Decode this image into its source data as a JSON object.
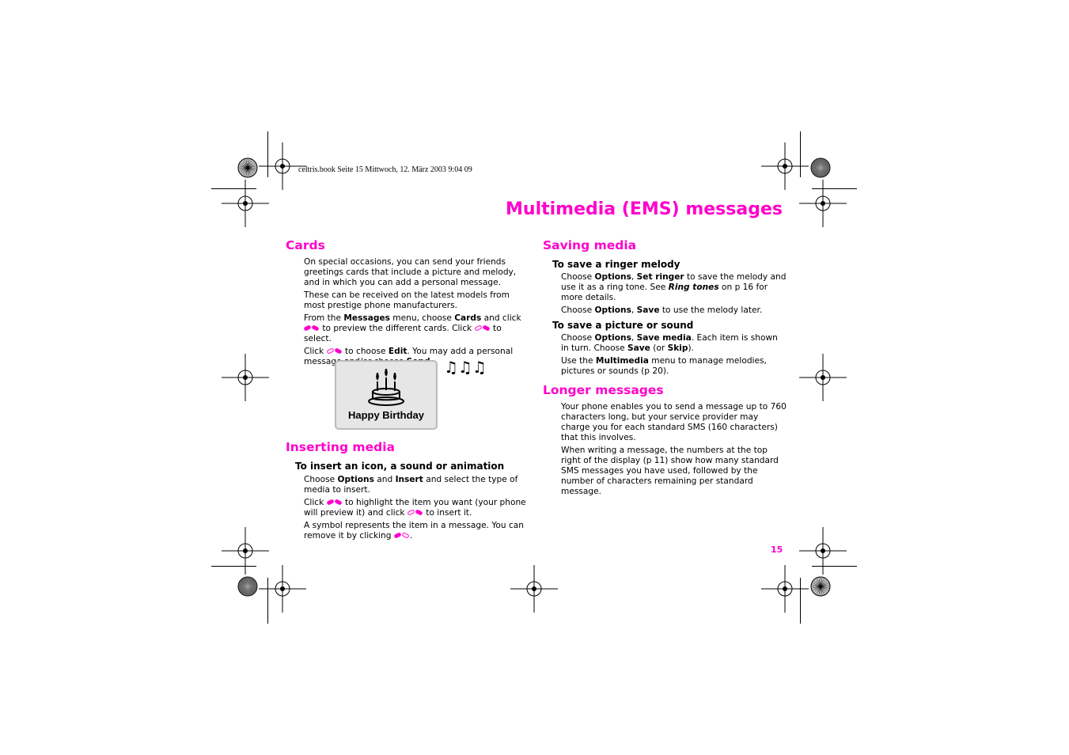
{
  "header": "celtris.book  Seite 15  Mittwoch, 12. März 2003  9:04 09",
  "title": "Multimedia (EMS) messages",
  "page_number": "15",
  "cards": {
    "heading": "Cards",
    "paragraphs": [
      [
        {
          "t": "On special occasions, you can send your friends greetings cards that include a picture and melody, and in which you can add a personal message."
        }
      ],
      [
        {
          "t": "These can be received on the latest models from most prestige phone manufacturers."
        }
      ],
      [
        {
          "t": "From the "
        },
        {
          "t": "Messages",
          "b": 1
        },
        {
          "t": " menu, choose "
        },
        {
          "t": "Cards",
          "b": 1
        },
        {
          "t": " and click "
        },
        {
          "icon": "nav-keys"
        },
        {
          "t": " to preview the different cards. Click "
        },
        {
          "icon": "ok-key"
        },
        {
          "t": " to select."
        }
      ],
      [
        {
          "t": "Click "
        },
        {
          "icon": "ok-key"
        },
        {
          "t": " to choose "
        },
        {
          "t": "Edit",
          "b": 1
        },
        {
          "t": ". You may add a personal message and/or choose "
        },
        {
          "t": "Send",
          "b": 1
        },
        {
          "t": "."
        }
      ]
    ],
    "card_label": "Happy Birthday",
    "notes": "♫♫♫"
  },
  "inserting": {
    "heading": "Inserting media",
    "subheading": "To insert an icon, a sound or animation",
    "paragraphs": [
      [
        {
          "t": "Choose "
        },
        {
          "t": "Options",
          "b": 1
        },
        {
          "t": " and "
        },
        {
          "t": "Insert",
          "b": 1
        },
        {
          "t": " and select the type of media to insert."
        }
      ],
      [
        {
          "t": "Click "
        },
        {
          "icon": "nav-keys"
        },
        {
          "t": " to highlight the item you want (your phone will preview it) and click "
        },
        {
          "icon": "ok-key"
        },
        {
          "t": " to insert it."
        }
      ],
      [
        {
          "t": "A symbol represents the item in a message. You can remove it by clicking "
        },
        {
          "icon": "back-key"
        },
        {
          "t": "."
        }
      ]
    ]
  },
  "saving": {
    "heading": "Saving media",
    "ringer": {
      "subheading": "To save a ringer melody",
      "paragraphs": [
        [
          {
            "t": "Choose "
          },
          {
            "t": "Options",
            "b": 1
          },
          {
            "t": ", "
          },
          {
            "t": "Set ringer",
            "b": 1
          },
          {
            "t": " to save the melody and use it as a ring tone. See "
          },
          {
            "t": "Ring tones",
            "b": 1,
            "i": 1
          },
          {
            "t": " on p 16 for more details."
          }
        ],
        [
          {
            "t": "Choose "
          },
          {
            "t": "Options",
            "b": 1
          },
          {
            "t": ", "
          },
          {
            "t": "Save",
            "b": 1
          },
          {
            "t": " to use the melody later."
          }
        ]
      ]
    },
    "picture": {
      "subheading": "To save a picture or sound",
      "paragraphs": [
        [
          {
            "t": "Choose "
          },
          {
            "t": "Options",
            "b": 1
          },
          {
            "t": ", "
          },
          {
            "t": "Save media",
            "b": 1
          },
          {
            "t": ".  Each item is shown in turn. Choose "
          },
          {
            "t": "Save",
            "b": 1
          },
          {
            "t": " (or "
          },
          {
            "t": "Skip",
            "b": 1
          },
          {
            "t": ")."
          }
        ],
        [
          {
            "t": "Use the "
          },
          {
            "t": "Multimedia",
            "b": 1
          },
          {
            "t": " menu to manage melodies, pictures or sounds (p 20)."
          }
        ]
      ]
    }
  },
  "longer": {
    "heading": "Longer messages",
    "paragraphs": [
      [
        {
          "t": "Your phone enables you to send a message up to 760 characters long, but your service provider may charge you for each standard SMS (160 characters) that this involves."
        }
      ],
      [
        {
          "t": "When writing a message, the numbers at the top right of the display (p 11) show how many standard SMS messages you have used, followed by the number of characters remaining per standard message."
        }
      ]
    ]
  },
  "colors": {
    "accent": "#ff00cc"
  }
}
